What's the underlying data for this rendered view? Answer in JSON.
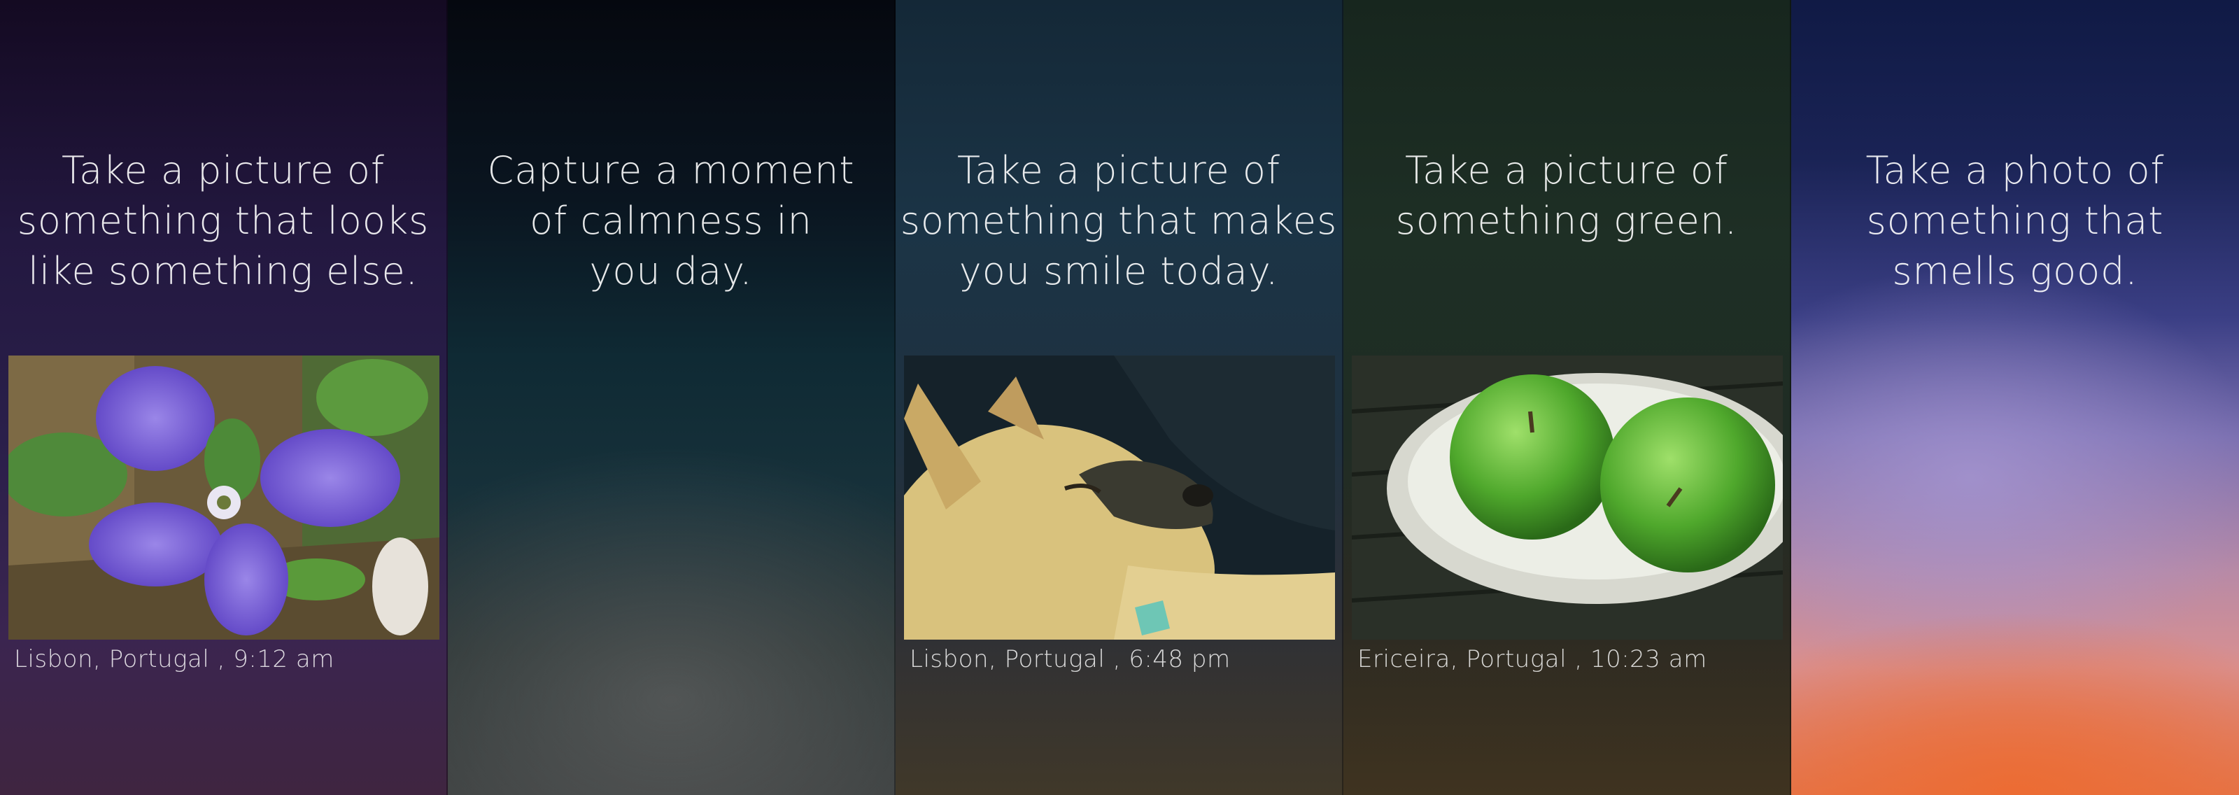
{
  "panels": [
    {
      "prompt": "Take a picture of\nsomething that looks\nlike something else.",
      "photo": "purple-violet-flower",
      "caption": "Lisbon, Portugal , 9:12 am"
    },
    {
      "prompt": "Capture a moment\nof calmness in\nyou day."
    },
    {
      "prompt": "Take a picture of\nsomething that makes\nyou smile today.",
      "photo": "sleeping-puppy",
      "caption": "Lisbon, Portugal , 6:48 pm"
    },
    {
      "prompt": "Take a picture of\nsomething green.",
      "photo": "green-apples-in-bowl",
      "caption": "Ericeira, Portugal , 10:23 am"
    },
    {
      "prompt": "Take a photo of\nsomething that\nsmells good."
    }
  ]
}
